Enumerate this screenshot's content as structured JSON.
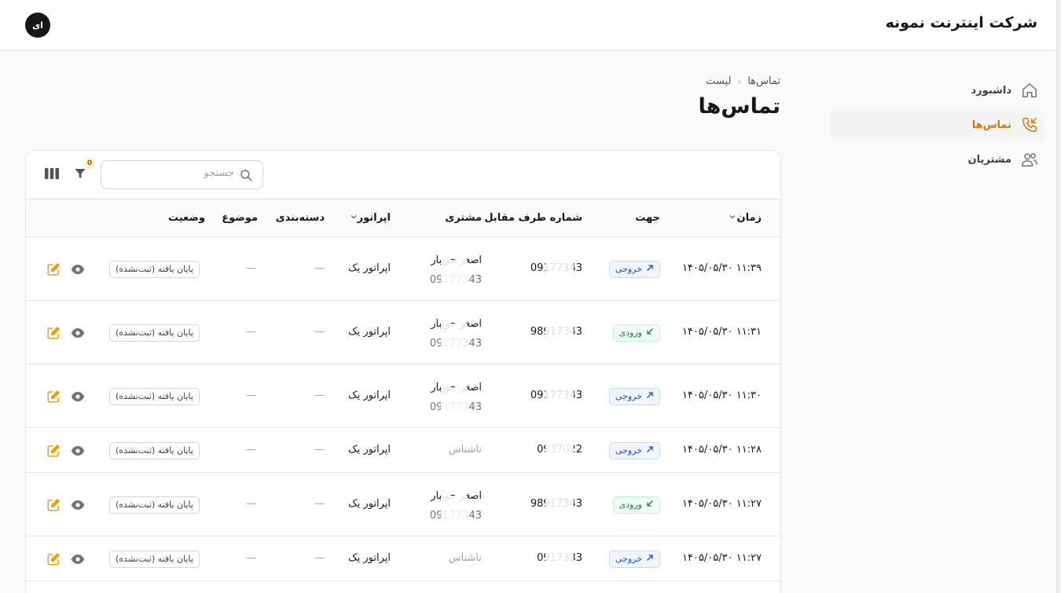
{
  "header": {
    "company": "شرکت اینترنت نمونه",
    "avatar_initials": "ای"
  },
  "sidebar": {
    "items": [
      {
        "label": "داشبورد",
        "icon": "home-icon",
        "active": false
      },
      {
        "label": "تماس‌ها",
        "icon": "phone-incoming-icon",
        "active": true
      },
      {
        "label": "مشتریان",
        "icon": "users-icon",
        "active": false
      }
    ]
  },
  "breadcrumb": {
    "root": "تماس‌ها",
    "current": "لیست"
  },
  "page": {
    "title": "تماس‌ها"
  },
  "toolbar": {
    "search_placeholder": "جستجو",
    "filter_count": "0"
  },
  "table": {
    "headers": {
      "time": "زمان",
      "direction": "جهت",
      "counterpart": "شماره طرف مقابل",
      "customer": "مشتری",
      "operator": "اپراتور",
      "category": "دسته‌بندی",
      "subject": "موضوع",
      "status": "وضعیت"
    },
    "rows": [
      {
        "time": "۱۴۰۵/۰۵/۳۰ ۱۱:۳۹",
        "direction": "خروجی",
        "dir_type": "out",
        "phone": "09177343",
        "customer_name": "اصغر جویبار",
        "customer_phone": "09177343",
        "operator": "اپراتور یک",
        "category": "—",
        "subject": "—",
        "status": "پایان یافته (ثبت‌نشده)"
      },
      {
        "time": "۱۴۰۵/۰۵/۳۰ ۱۱:۳۱",
        "direction": "ورودی",
        "dir_type": "in",
        "phone": "98917343",
        "customer_name": "اصغر جویبار",
        "customer_phone": "09177343",
        "operator": "اپراتور یک",
        "category": "—",
        "subject": "—",
        "status": "پایان یافته (ثبت‌نشده)"
      },
      {
        "time": "۱۴۰۵/۰۵/۳۰ ۱۱:۳۰",
        "direction": "خروجی",
        "dir_type": "out",
        "phone": "09177343",
        "customer_name": "اصغر جویبار",
        "customer_phone": "09177343",
        "operator": "اپراتور یک",
        "category": "—",
        "subject": "—",
        "status": "پایان یافته (ثبت‌نشده)"
      },
      {
        "time": "۱۴۰۵/۰۵/۳۰ ۱۱:۲۸",
        "direction": "خروجی",
        "dir_type": "out",
        "phone": "0937022",
        "customer_unknown": "ناشناس",
        "operator": "اپراتور یک",
        "category": "—",
        "subject": "—",
        "status": "پایان یافته (ثبت‌نشده)"
      },
      {
        "time": "۱۴۰۵/۰۵/۳۰ ۱۱:۲۷",
        "direction": "ورودی",
        "dir_type": "in",
        "phone": "98917343",
        "customer_name": "اصغر جویبار",
        "customer_phone": "09177343",
        "operator": "اپراتور یک",
        "category": "—",
        "subject": "—",
        "status": "پایان یافته (ثبت‌نشده)"
      },
      {
        "time": "۱۴۰۵/۰۵/۳۰ ۱۱:۲۷",
        "direction": "خروجی",
        "dir_type": "out",
        "phone": "0917333",
        "customer_unknown": "ناشناس",
        "operator": "اپراتور یک",
        "category": "—",
        "subject": "—",
        "status": "پایان یافته (ثبت‌نشده)"
      }
    ]
  }
}
